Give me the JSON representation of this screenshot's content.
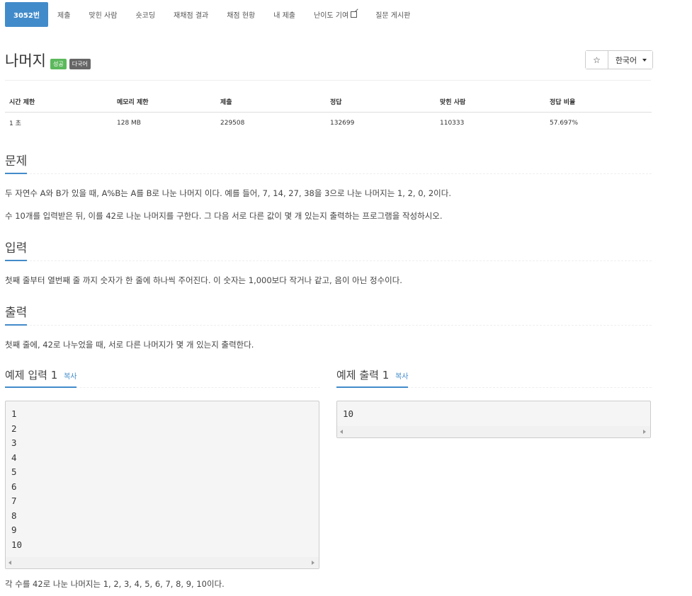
{
  "nav": {
    "tabs": [
      "3052번",
      "제출",
      "맞힌 사람",
      "숏코딩",
      "재채점 결과",
      "채점 현황",
      "내 제출",
      "난이도 기여",
      "질문 게시판"
    ],
    "active_index": 0
  },
  "problem": {
    "title": "나머지",
    "badges": [
      "성공",
      "다국어"
    ],
    "star": "☆",
    "language": "한국어"
  },
  "info_table": {
    "headers": [
      "시간 제한",
      "메모리 제한",
      "제출",
      "정답",
      "맞힌 사람",
      "정답 비율"
    ],
    "row": [
      "1 초",
      "128 MB",
      "229508",
      "132699",
      "110333",
      "57.697%"
    ]
  },
  "sections": {
    "problem_title": "문제",
    "problem_lines": [
      "두 자연수 A와 B가 있을 때, A%B는 A를 B로 나눈 나머지 이다. 예를 들어, 7, 14, 27, 38을 3으로 나눈 나머지는 1, 2, 0, 2이다.",
      "수 10개를 입력받은 뒤, 이를 42로 나눈 나머지를 구한다. 그 다음 서로 다른 값이 몇 개 있는지 출력하는 프로그램을 작성하시오."
    ],
    "input_title": "입력",
    "input_text": "첫째 줄부터 열번째 줄 까지 숫자가 한 줄에 하나씩 주어진다. 이 숫자는 1,000보다 작거나 같고, 음이 아닌 정수이다.",
    "output_title": "출력",
    "output_text": "첫째 줄에, 42로 나누었을 때, 서로 다른 나머지가 몇 개 있는지 출력한다."
  },
  "samples": {
    "input_title": "예제 입력 1",
    "output_title": "예제 출력 1",
    "copy_label": "복사",
    "input_text": "1\n2\n3\n4\n5\n6\n7\n8\n9\n10",
    "output_text": "10",
    "hint": "각 수를 42로 나눈 나머지는 1, 2, 3, 4, 5, 6, 7, 8, 9, 10이다."
  },
  "colors": {
    "accent": "#428bca",
    "success": "#5cb85c",
    "badge_gray": "#666666"
  }
}
